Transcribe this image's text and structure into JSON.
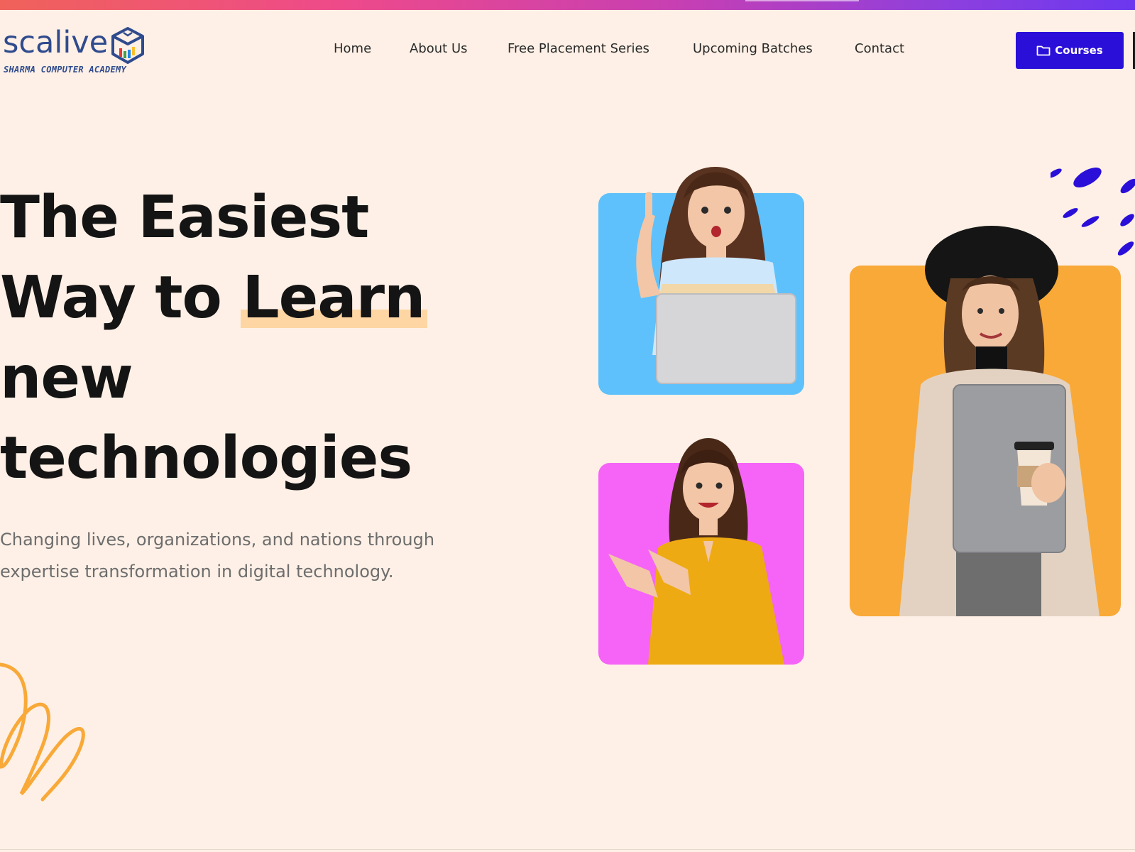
{
  "brand": {
    "name": "scalive",
    "tagline": "SHARMA COMPUTER ACADEMY"
  },
  "nav": {
    "items": [
      {
        "label": "Home"
      },
      {
        "label": "About Us"
      },
      {
        "label": "Free Placement Series"
      },
      {
        "label": "Upcoming Batches"
      },
      {
        "label": "Contact"
      }
    ],
    "cta_label": "Courses"
  },
  "hero": {
    "line1": "The Easiest",
    "line2_pre": "Way to ",
    "line2_highlight": "Learn",
    "line3": "new",
    "line4": "technologies",
    "sub_line1": "Changing lives, organizations, and nations through",
    "sub_line2": "expertise transformation in digital technology."
  },
  "colors": {
    "background": "#fef0e6",
    "accent": "#2a0fd9",
    "highlight": "#fed6a3",
    "card_blue": "#5ec1fb",
    "card_pink": "#f564f6",
    "card_orange": "#f8a938",
    "squiggle": "#f8a938"
  },
  "icons": {
    "courses_button_icon": "folder-icon"
  }
}
